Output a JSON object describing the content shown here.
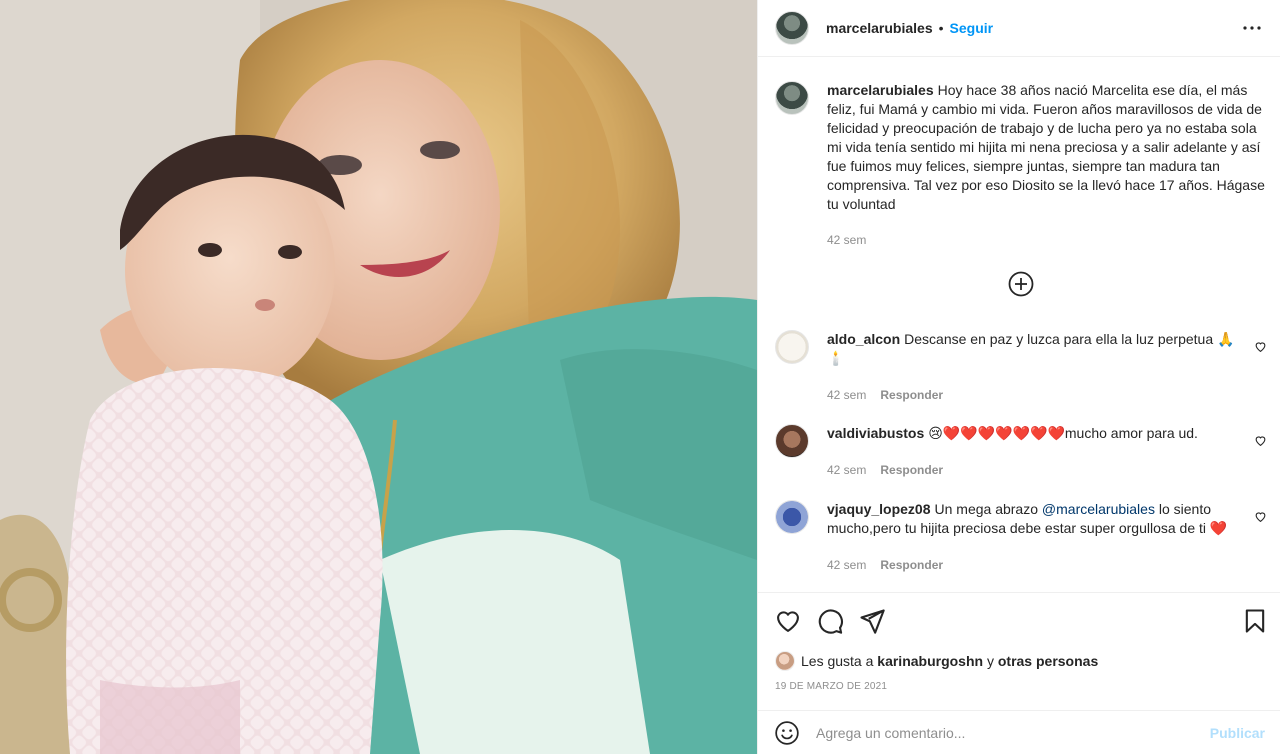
{
  "post": {
    "username": "marcelarubiales",
    "follow_label": "Seguir",
    "separator": "•"
  },
  "caption": {
    "username": "marcelarubiales",
    "text": "Hoy hace 38 años nació Marcelita ese día, el más feliz, fui Mamá y cambio mi vida. Fueron años maravillosos de vida de felicidad y preocupación de trabajo y de lucha pero ya no estaba sola mi vida tenía sentido mi hijita mi nena preciosa y a salir adelante y así fue fuimos muy felices, siempre juntas, siempre tan madura tan comprensiva. Tal vez por eso Diosito se la llevó hace 17 años. Hágase tu voluntad",
    "time": "42 sem"
  },
  "comments": [
    {
      "username": "aldo_alcon",
      "text": "Descanse en paz y luzca para ella la luz perpetua 🙏🕯️",
      "time": "42 sem",
      "reply": "Responder"
    },
    {
      "username": "valdiviabustos",
      "text": "😢❤️❤️❤️❤️❤️❤️❤️mucho amor para ud.",
      "time": "42 sem",
      "reply": "Responder"
    },
    {
      "username": "vjaquy_lopez08",
      "text_before": "Un mega abrazo",
      "mention": "@marcelarubiales",
      "text_after": "lo siento mucho,pero tu hijita preciosa debe estar super orgullosa de ti ❤️",
      "time": "42 sem",
      "reply": "Responder"
    }
  ],
  "likes": {
    "prefix": "Les gusta a",
    "user": "karinaburgoshn",
    "conj": "y",
    "others": "otras personas"
  },
  "date": "19 DE MARZO DE 2021",
  "compose": {
    "placeholder": "Agrega un comentario...",
    "publish": "Publicar"
  },
  "colors": {
    "accent": "#0095f6",
    "publish_disabled": "#b2dffc",
    "muted": "#8e8e8e",
    "mention": "#00376b"
  },
  "icons": [
    "more-options-icon",
    "add-comment-icon",
    "heart-icon",
    "comment-icon",
    "share-icon",
    "bookmark-icon",
    "emoji-icon"
  ]
}
